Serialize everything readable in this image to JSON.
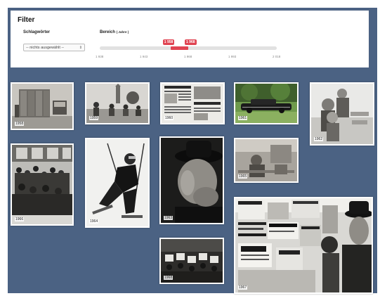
{
  "filter": {
    "title": "Filter",
    "keywords_label": "Schlagwörter",
    "keywords_select_value": "-- nichts ausgewählt --",
    "range_label": "Bereich",
    "range_unit": "( Jahre )",
    "range_min_value": "1 958",
    "range_max_value": "1 968",
    "range_start_fraction": 0.4,
    "range_end_fraction": 0.5,
    "ticks": [
      "1 938",
      "1 943",
      "1 968",
      "1 993",
      "2 018"
    ],
    "accent_color": "#e04452"
  },
  "photos": [
    {
      "id": "photo-1958",
      "year": "1958",
      "scene": "computer-room"
    },
    {
      "id": "photo-1959",
      "year": "1959",
      "scene": "street-group"
    },
    {
      "id": "photo-1960",
      "year": "1960",
      "scene": "newspaper"
    },
    {
      "id": "photo-1961",
      "year": "1961",
      "scene": "limousine"
    },
    {
      "id": "photo-1962",
      "year": "1962",
      "scene": "children"
    },
    {
      "id": "photo-1966",
      "year": "1966",
      "scene": "crowd"
    },
    {
      "id": "photo-1964",
      "year": "1964",
      "scene": "skier"
    },
    {
      "id": "photo-1963",
      "year": "1963",
      "scene": "portrait"
    },
    {
      "id": "photo-1965",
      "year": "1965",
      "scene": "interior"
    },
    {
      "id": "photo-1968",
      "year": "1968",
      "scene": "demonstration"
    },
    {
      "id": "photo-1967",
      "year": "1967",
      "scene": "newsstand"
    }
  ],
  "colors": {
    "background": "#4b6283",
    "panel": "#ffffff"
  }
}
